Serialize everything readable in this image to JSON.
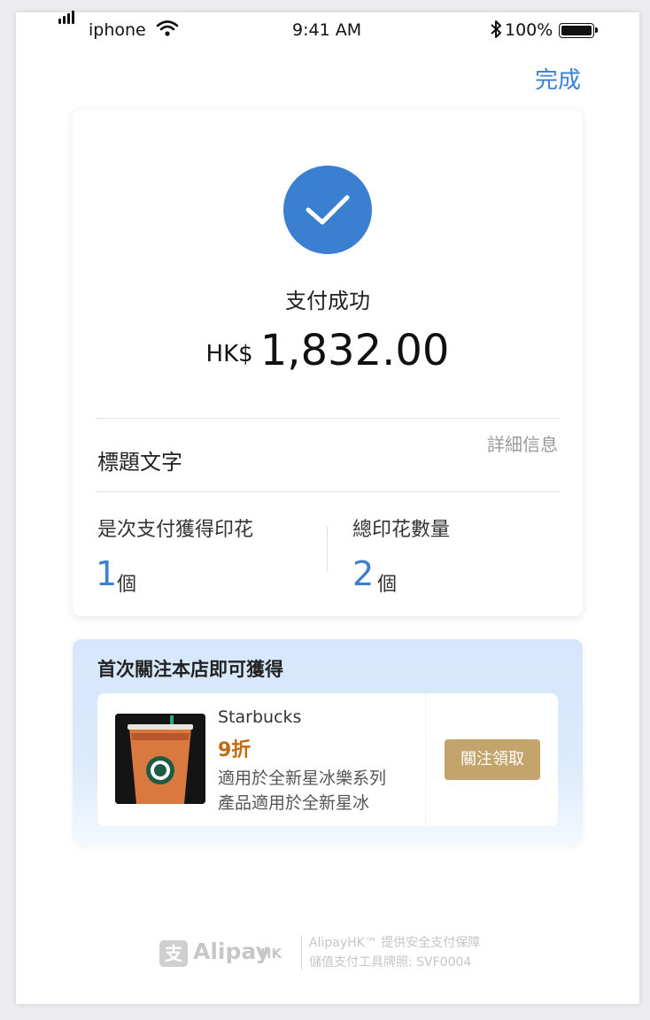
{
  "status_bar": {
    "carrier": "iphone",
    "time": "9:41 AM",
    "battery": "100%"
  },
  "header": {
    "done_label": "完成"
  },
  "result": {
    "status": "支付成功",
    "currency": "HK$",
    "amount": "1,832.00",
    "title_text": "標題文字",
    "detail_link": "詳細信息",
    "stamps_this_label": "是次支付獲得印花",
    "stamps_this_value": "1",
    "stamps_this_unit": "個",
    "stamps_total_label": "總印花數量",
    "stamps_total_value": "2",
    "stamps_total_unit": "個"
  },
  "promo": {
    "title": "首次關注本店即可獲得",
    "store": "Starbucks",
    "discount": "9折",
    "desc_line1": "適用於全新星冰樂系列",
    "desc_line2": "產品適用於全新星冰",
    "button": "關注領取"
  },
  "footer": {
    "logo_text": "Alipay",
    "logo_sub": "HK",
    "line1": "AlipayHK™ 提供安全支付保障",
    "line2": "儲值支付工具牌照: SVF0004"
  },
  "colors": {
    "accent": "#3a7fd0",
    "discount": "#c26a10",
    "button": "#c2a46c"
  }
}
